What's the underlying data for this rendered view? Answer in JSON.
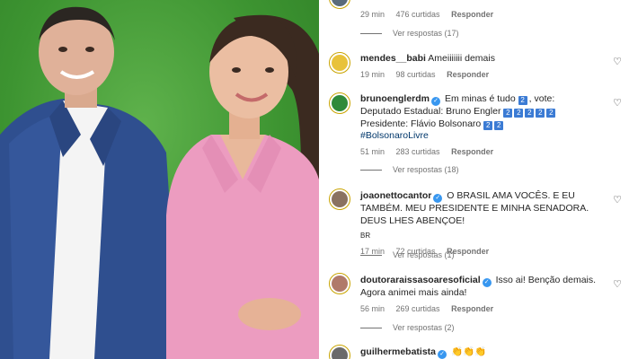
{
  "comments": [
    {
      "meta": {
        "time": "29 min",
        "likes": "476 curtidas",
        "reply": "Responder"
      },
      "replies": "Ver respostas (17)"
    },
    {
      "user": "mendes__babi",
      "verified": false,
      "text": "Ameiiiiiii demais",
      "meta": {
        "time": "19 min",
        "likes": "98 curtidas",
        "reply": "Responder"
      }
    },
    {
      "user": "bruno​englerdm",
      "verified": true,
      "line1": "Em minas é tudo",
      "line1_end": ", vote:",
      "line2": "Deputado Estadual: Bruno Engler",
      "line3": "Presidente: Flávio Bolsonaro",
      "hashtag": "#BolsonaroLivre",
      "box_glyph": "2",
      "meta": {
        "time": "51 min",
        "likes": "283 curtidas",
        "reply": "Responder"
      },
      "replies": "Ver respostas (18)"
    },
    {
      "user": "joaonettocantor",
      "verified": true,
      "text": "O BRASIL AMA VOCÊS. E EU TAMBÉM. MEU PRESIDENTE E MINHA SENADORA. DEUS LHES ABENÇOE!",
      "note": "BR",
      "meta": {
        "time": "17 min",
        "likes": "72 curtidas",
        "reply": "Responder"
      },
      "replies": "Ver respostas (1)"
    },
    {
      "user": "doutoraraissasoaresoficial",
      "verified": true,
      "text": "Isso ai! Benção demais. Agora animei mais ainda!",
      "meta": {
        "time": "56 min",
        "likes": "269 curtidas",
        "reply": "Responder"
      },
      "replies": "Ver respostas (2)"
    },
    {
      "user": "guilhermebatista",
      "verified": true,
      "text": "👏👏👏"
    }
  ],
  "icons": {
    "heart": "heart-outline-icon",
    "verified": "verified-badge-icon"
  },
  "colors": {
    "greenscreen": "#3f9a33",
    "verified": "#3897f0",
    "muted": "#737373"
  }
}
